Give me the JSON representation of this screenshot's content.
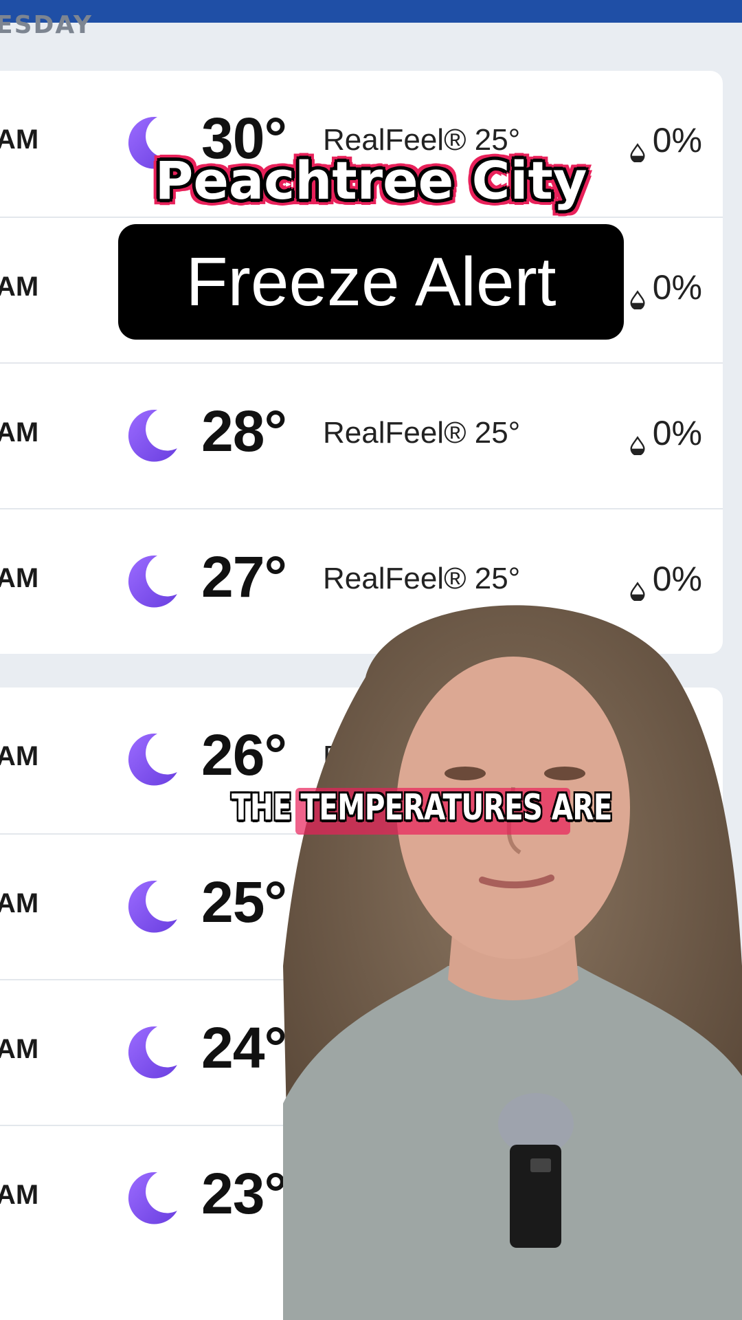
{
  "day_label": "ESDAY",
  "overlay": {
    "title": "Peachtree City",
    "alert": "Freeze Alert",
    "caption": "THE TEMPERATURES ARE"
  },
  "card1": [
    {
      "time": "AM",
      "icon": "moon-icon",
      "temp": "30°",
      "realfeel": "RealFeel® 25°",
      "precip": "0%"
    },
    {
      "time": "AM",
      "icon": "moon-icon",
      "temp": "",
      "realfeel": "",
      "precip": "0%"
    },
    {
      "time": "AM",
      "icon": "moon-icon",
      "temp": "28°",
      "realfeel": "RealFeel® 25°",
      "precip": "0%"
    },
    {
      "time": "AM",
      "icon": "moon-icon",
      "temp": "27°",
      "realfeel": "RealFeel® 25°",
      "precip": "0%"
    }
  ],
  "card2": [
    {
      "time": "AM",
      "icon": "moon-icon",
      "temp": "26°",
      "realfeel": "R",
      "precip": ""
    },
    {
      "time": "AM",
      "icon": "moon-icon",
      "temp": "25°",
      "realfeel": "",
      "precip": ""
    },
    {
      "time": "AM",
      "icon": "moon-icon",
      "temp": "24°",
      "realfeel": "",
      "precip": ""
    },
    {
      "time": "AM",
      "icon": "moon-icon",
      "temp": "23°",
      "realfeel": "",
      "precip": ""
    }
  ],
  "colors": {
    "moon": "#6a3fe0",
    "accent_pink": "#e8215a",
    "header_blue": "#1f4fa6"
  }
}
